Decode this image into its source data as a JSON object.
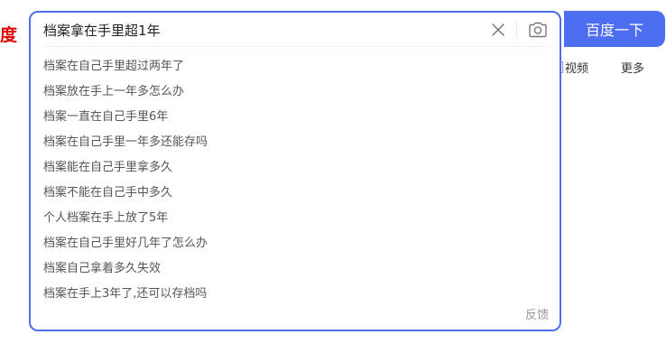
{
  "logo": {
    "text": "度"
  },
  "search": {
    "query": "档案拿在手里超1年",
    "button_label": "百度一下",
    "feedback_label": "反馈"
  },
  "suggestions": [
    "档案在自己手里超过两年了",
    "档案放在手上一年多怎么办",
    "档案一直在自己手里6年",
    "档案在自己手里一年多还能存吗",
    "档案能在自己手里拿多久",
    "档案不能在自己手中多久",
    "个人档案在手上放了5年",
    "档案在自己手里好几年了怎么办",
    "档案自己拿着多久失效",
    "档案在手上3年了,还可以存档吗"
  ],
  "nav": {
    "video": "视频",
    "more": "更多"
  },
  "icons": {
    "clear": "close-icon",
    "camera": "camera-icon"
  },
  "colors": {
    "accent": "#4e6ef2",
    "logo_red": "#e10602"
  }
}
